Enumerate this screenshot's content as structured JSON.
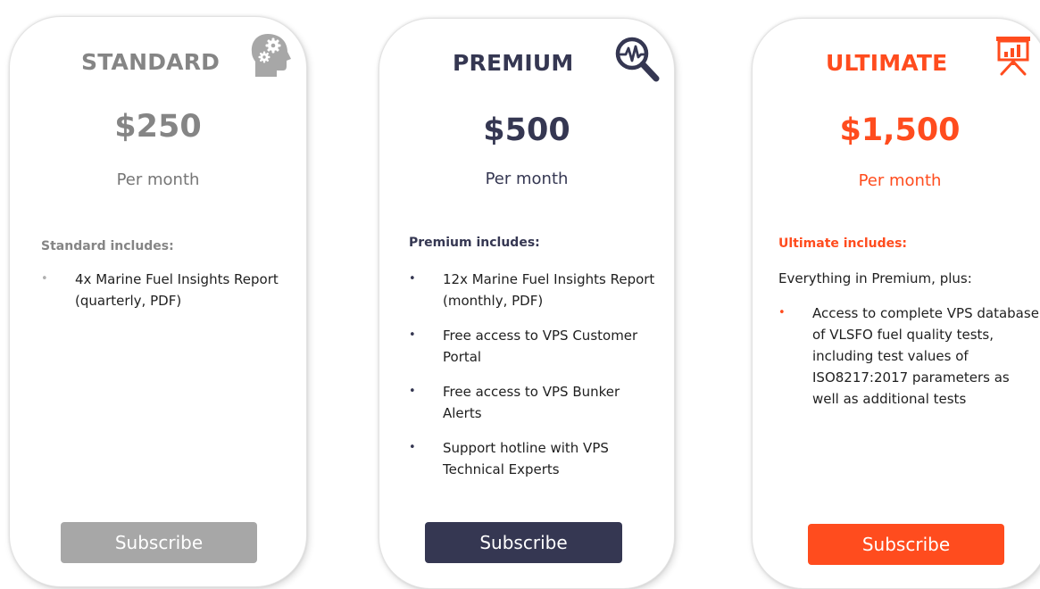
{
  "plans": [
    {
      "title": "STANDARD",
      "icon": "brain-gears-icon",
      "price": "$250",
      "period": "Per month",
      "includes_heading": "Standard includes:",
      "intro": "",
      "features": [
        "4x Marine Fuel Insights Report (quarterly, PDF)"
      ],
      "button_label": "Subscribe",
      "color": "#858585",
      "button_color": "#a7a7a7"
    },
    {
      "title": "PREMIUM",
      "icon": "magnifier-pulse-icon",
      "price": "$500",
      "period": "Per month",
      "includes_heading": "Premium includes:",
      "intro": "",
      "features": [
        "12x Marine Fuel Insights Report (monthly, PDF)",
        "Free access to VPS Customer Portal",
        "Free access to VPS Bunker Alerts",
        "Support hotline with VPS Technical Experts"
      ],
      "button_label": "Subscribe",
      "color": "#353752",
      "button_color": "#353752"
    },
    {
      "title": "ULTIMATE",
      "icon": "presentation-chart-icon",
      "price": "$1,500",
      "period": "Per month",
      "includes_heading": "Ultimate includes:",
      "intro": "Everything in Premium, plus:",
      "features": [
        "Access to complete VPS database of VLSFO fuel quality tests, including test values of ISO8217:2017 parameters as well as additional tests"
      ],
      "button_label": "Subscribe",
      "color": "#ff4c1e",
      "button_color": "#ff4c1e"
    }
  ],
  "bullet_glyph": "•"
}
